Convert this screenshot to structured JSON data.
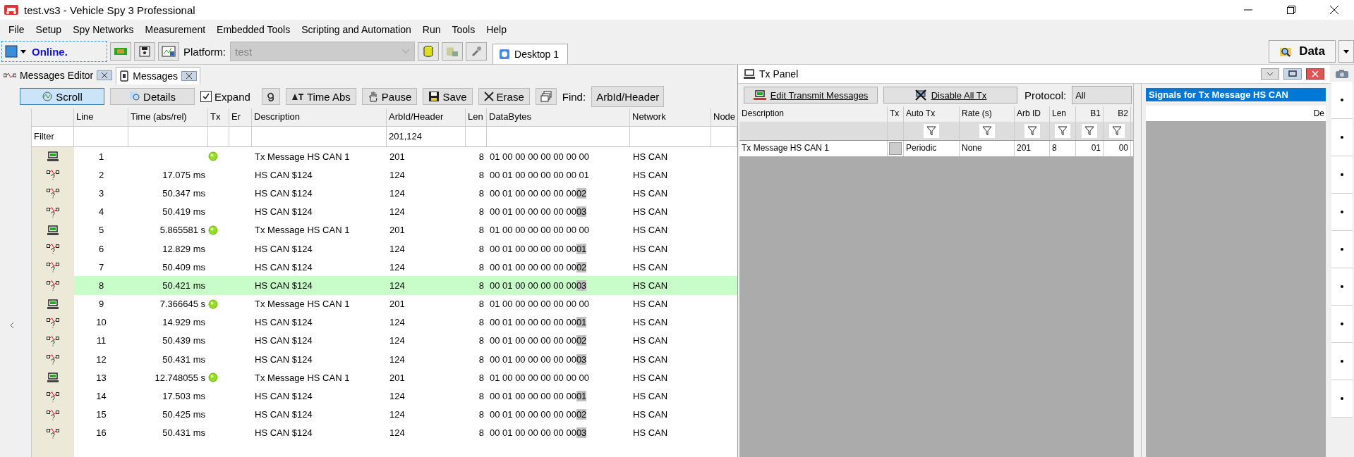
{
  "window": {
    "title": "test.vs3 - Vehicle Spy 3 Professional"
  },
  "menu": [
    "File",
    "Setup",
    "Spy Networks",
    "Measurement",
    "Embedded Tools",
    "Scripting and Automation",
    "Run",
    "Tools",
    "Help"
  ],
  "toolbar": {
    "status": "Online.",
    "platform_label": "Platform:",
    "platform_value": "test",
    "desktop_tab": "Desktop 1",
    "data_button": "Data"
  },
  "panel_tabs": [
    {
      "label": "Messages Editor",
      "selected": false
    },
    {
      "label": "Messages",
      "selected": true
    }
  ],
  "messages": {
    "view_buttons": [
      {
        "label": "Scroll",
        "selected": true
      },
      {
        "label": "Details",
        "selected": false
      }
    ],
    "expand": {
      "label": "Expand",
      "checked": true
    },
    "tools": [
      {
        "kind": "curl"
      },
      {
        "kind": "time",
        "label": "Time Abs"
      },
      {
        "kind": "hand",
        "label": "Pause"
      },
      {
        "kind": "disk",
        "label": "Save"
      },
      {
        "kind": "erase",
        "label": "Erase"
      },
      {
        "kind": "windows"
      }
    ],
    "find_label": "Find:",
    "find_value": "ArbId/Header",
    "columns": [
      "Line",
      "Time (abs/rel)",
      "Tx",
      "Er",
      "Description",
      "ArbId/Header",
      "Len",
      "DataBytes",
      "Network",
      "Node"
    ],
    "filter_label": "Filter",
    "arb_filter": "201,124",
    "rows": [
      {
        "kind": "tx",
        "line": "1",
        "tx": true,
        "description": "Tx Message HS CAN 1",
        "arb_id": "201",
        "len": "8",
        "data": "01 00 00 00 00 00 00 00",
        "network": "HS CAN",
        "selected": false
      },
      {
        "kind": "rx",
        "line": "2",
        "time": "17.075 ms",
        "tx": false,
        "description": "HS CAN $124",
        "arb_id": "124",
        "len": "8",
        "data": "00 01 00 00 00 00 00 01",
        "network": "HS CAN",
        "selected": false
      },
      {
        "kind": "rx",
        "line": "3",
        "time": "50.347 ms",
        "tx": false,
        "description": "HS CAN $124",
        "arb_id": "124",
        "len": "8",
        "data": "00 01 00 00 00 00 00",
        "changed_byte": "02",
        "network": "HS CAN",
        "selected": false
      },
      {
        "kind": "rx",
        "line": "4",
        "time": "50.419 ms",
        "tx": false,
        "description": "HS CAN $124",
        "arb_id": "124",
        "len": "8",
        "data": "00 01 00 00 00 00 00",
        "changed_byte": "03",
        "network": "HS CAN",
        "selected": false
      },
      {
        "kind": "tx",
        "line": "5",
        "time": "5.865581 s",
        "tx": true,
        "description": "Tx Message HS CAN 1",
        "arb_id": "201",
        "len": "8",
        "data": "01 00 00 00 00 00 00 00",
        "network": "HS CAN",
        "selected": false
      },
      {
        "kind": "rx",
        "line": "6",
        "time": "12.829 ms",
        "tx": false,
        "description": "HS CAN $124",
        "arb_id": "124",
        "len": "8",
        "data": "00 01 00 00 00 00 00",
        "changed_byte": "01",
        "network": "HS CAN",
        "selected": false
      },
      {
        "kind": "rx",
        "line": "7",
        "time": "50.409 ms",
        "tx": false,
        "description": "HS CAN $124",
        "arb_id": "124",
        "len": "8",
        "data": "00 01 00 00 00 00 00",
        "changed_byte": "02",
        "network": "HS CAN",
        "selected": false
      },
      {
        "kind": "rx",
        "line": "8",
        "time": "50.421 ms",
        "tx": false,
        "description": "HS CAN $124",
        "arb_id": "124",
        "len": "8",
        "data": "00 01 00 00 00 00 00",
        "changed_byte": "03",
        "network": "HS CAN",
        "selected": true
      },
      {
        "kind": "tx",
        "line": "9",
        "time": "7.366645 s",
        "tx": true,
        "description": "Tx Message HS CAN 1",
        "arb_id": "201",
        "len": "8",
        "data": "01 00 00 00 00 00 00 00",
        "network": "HS CAN",
        "selected": false
      },
      {
        "kind": "rx",
        "line": "10",
        "time": "14.929 ms",
        "tx": false,
        "description": "HS CAN $124",
        "arb_id": "124",
        "len": "8",
        "data": "00 01 00 00 00 00 00",
        "changed_byte": "01",
        "network": "HS CAN",
        "selected": false
      },
      {
        "kind": "rx",
        "line": "11",
        "time": "50.439 ms",
        "tx": false,
        "description": "HS CAN $124",
        "arb_id": "124",
        "len": "8",
        "data": "00 01 00 00 00 00 00",
        "changed_byte": "02",
        "network": "HS CAN",
        "selected": false
      },
      {
        "kind": "rx",
        "line": "12",
        "time": "50.431 ms",
        "tx": false,
        "description": "HS CAN $124",
        "arb_id": "124",
        "len": "8",
        "data": "00 01 00 00 00 00 00",
        "changed_byte": "03",
        "network": "HS CAN",
        "selected": false
      },
      {
        "kind": "tx",
        "line": "13",
        "time": "12.748055 s",
        "tx": true,
        "description": "Tx Message HS CAN 1",
        "arb_id": "201",
        "len": "8",
        "data": "01 00 00 00 00 00 00 00",
        "network": "HS CAN",
        "selected": false
      },
      {
        "kind": "rx",
        "line": "14",
        "time": "17.503 ms",
        "tx": false,
        "description": "HS CAN $124",
        "arb_id": "124",
        "len": "8",
        "data": "00 01 00 00 00 00 00",
        "changed_byte": "01",
        "network": "HS CAN",
        "selected": false
      },
      {
        "kind": "rx",
        "line": "15",
        "time": "50.425 ms",
        "tx": false,
        "description": "HS CAN $124",
        "arb_id": "124",
        "len": "8",
        "data": "00 01 00 00 00 00 00",
        "changed_byte": "02",
        "network": "HS CAN",
        "selected": false
      },
      {
        "kind": "rx",
        "line": "16",
        "time": "50.431 ms",
        "tx": false,
        "description": "HS CAN $124",
        "arb_id": "124",
        "len": "8",
        "data": "00 01 00 00 00 00 00",
        "changed_byte": "03",
        "network": "HS CAN",
        "selected": false
      }
    ]
  },
  "tx_panel": {
    "title": "Tx Panel",
    "edit_button": "Edit Transmit Messages",
    "disable_button": "Disable All Tx",
    "protocol_label": "Protocol:",
    "protocol_value": "All",
    "columns": [
      "Description",
      "Tx",
      "Auto Tx",
      "Rate (s)",
      "Arb ID",
      "Len",
      "B1",
      "B2"
    ],
    "rows": [
      {
        "description": "Tx Message HS CAN 1",
        "tx_checked": false,
        "auto_tx": "Periodic",
        "rate": "None",
        "arb_id": "201",
        "len": "8",
        "b1": "01",
        "b2": "00"
      }
    ]
  },
  "signals": {
    "title": "Signals for Tx Message HS CAN",
    "column": "De"
  }
}
